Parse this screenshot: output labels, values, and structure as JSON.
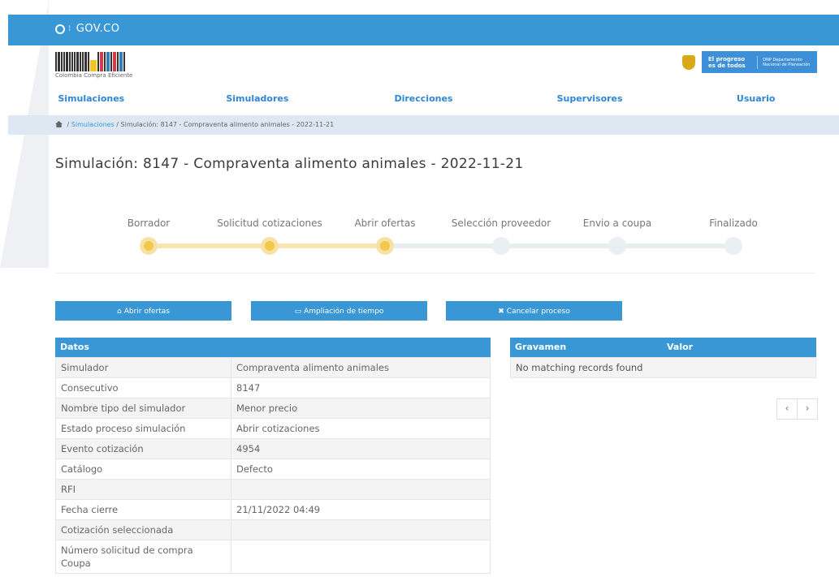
{
  "gov_bar": {
    "logo_text": "GOV.CO"
  },
  "brand": {
    "name": "Colombia Compra Eficiente"
  },
  "gov_badge": {
    "slogan": "El progreso es de todos",
    "entity": "DNP Departamento Nacional de Planeación"
  },
  "nav": [
    "Simulaciones",
    "Simuladores",
    "Direcciones",
    "Supervisores",
    "Usuario"
  ],
  "breadcrumb": {
    "link": "Simulaciones",
    "current": " / Simulación: 8147 - Compraventa alimento animales - 2022-11-21",
    "sep": " / "
  },
  "title": "Simulación: 8147 - Compraventa alimento animales - 2022-11-21",
  "steps": [
    {
      "label": "Borrador",
      "done": true
    },
    {
      "label": "Solicitud cotizaciones",
      "done": true
    },
    {
      "label": "Abrir ofertas",
      "done": true
    },
    {
      "label": "Selección proveedor",
      "done": false
    },
    {
      "label": "Envio a coupa",
      "done": false
    },
    {
      "label": "Finalizado",
      "done": false
    }
  ],
  "buttons": {
    "open": "Abrir ofertas",
    "extend": "Ampliación de tiempo",
    "cancel": "Cancelar proceso"
  },
  "datos": {
    "header": "Datos",
    "rows": [
      [
        "Simulador",
        "Compraventa alimento animales"
      ],
      [
        "Consecutivo",
        "8147"
      ],
      [
        "Nombre tipo del simulador",
        "Menor precio"
      ],
      [
        "Estado proceso simulación",
        "Abrir cotizaciones"
      ],
      [
        "Evento cotización",
        "4954"
      ],
      [
        "Catálogo",
        "Defecto"
      ],
      [
        "RFI",
        ""
      ],
      [
        "Fecha cierre",
        "21/11/2022 04:49"
      ],
      [
        "Cotización seleccionada",
        ""
      ],
      [
        "Número solicitud de compra Coupa",
        ""
      ]
    ]
  },
  "gravamen": {
    "col1": "Gravamen",
    "col2": "Valor",
    "empty": "No matching records found"
  },
  "pager": {
    "prev": "‹",
    "next": "›"
  },
  "colors": {
    "primary": "#3a97d6",
    "step_done": "#f2c94c",
    "step_todo": "#eaf0f1"
  }
}
